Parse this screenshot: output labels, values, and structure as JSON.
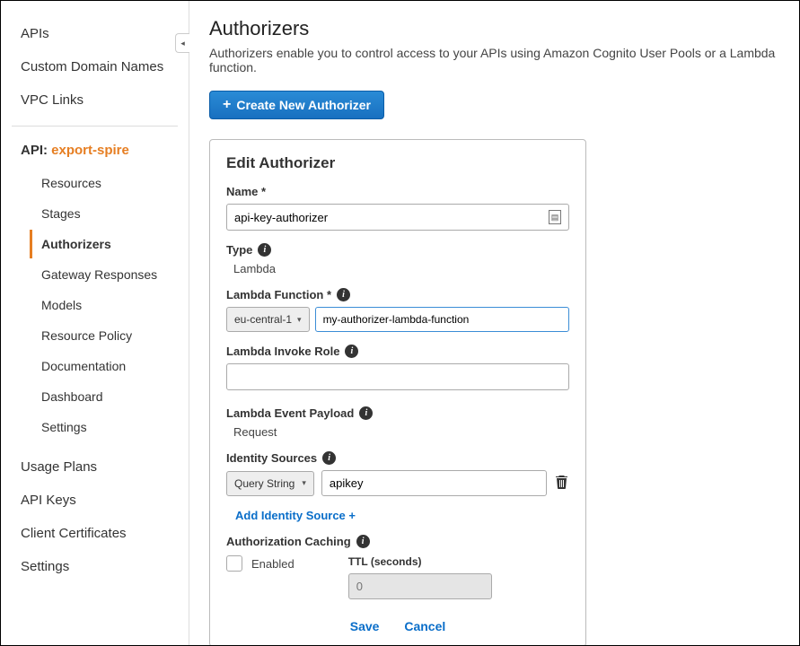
{
  "sidebar": {
    "top": [
      {
        "label": "APIs"
      },
      {
        "label": "Custom Domain Names"
      },
      {
        "label": "VPC Links"
      }
    ],
    "api_prefix": "API: ",
    "api_name": "export-spire",
    "sub": [
      {
        "label": "Resources"
      },
      {
        "label": "Stages"
      },
      {
        "label": "Authorizers",
        "active": true
      },
      {
        "label": "Gateway Responses"
      },
      {
        "label": "Models"
      },
      {
        "label": "Resource Policy"
      },
      {
        "label": "Documentation"
      },
      {
        "label": "Dashboard"
      },
      {
        "label": "Settings"
      }
    ],
    "bottom": [
      {
        "label": "Usage Plans"
      },
      {
        "label": "API Keys"
      },
      {
        "label": "Client Certificates"
      },
      {
        "label": "Settings"
      }
    ]
  },
  "header": {
    "title": "Authorizers",
    "description": "Authorizers enable you to control access to your APIs using Amazon Cognito User Pools or a Lambda function.",
    "create_button": "Create New Authorizer"
  },
  "form": {
    "card_title": "Edit Authorizer",
    "name_label": "Name *",
    "name_value": "api-key-authorizer",
    "type_label": "Type",
    "type_value": "Lambda",
    "lambda_fn_label": "Lambda Function *",
    "region": "eu-central-1",
    "lambda_fn_value": "my-authorizer-lambda-function",
    "invoke_role_label": "Lambda Invoke Role",
    "invoke_role_value": "",
    "payload_label": "Lambda Event Payload",
    "payload_value": "Request",
    "identity_label": "Identity Sources",
    "identity_type": "Query String",
    "identity_value": "apikey",
    "add_identity_label": "Add Identity Source +",
    "cache_label": "Authorization Caching",
    "cache_enabled_label": "Enabled",
    "ttl_label": "TTL (seconds)",
    "ttl_placeholder": "0",
    "save_label": "Save",
    "cancel_label": "Cancel"
  }
}
